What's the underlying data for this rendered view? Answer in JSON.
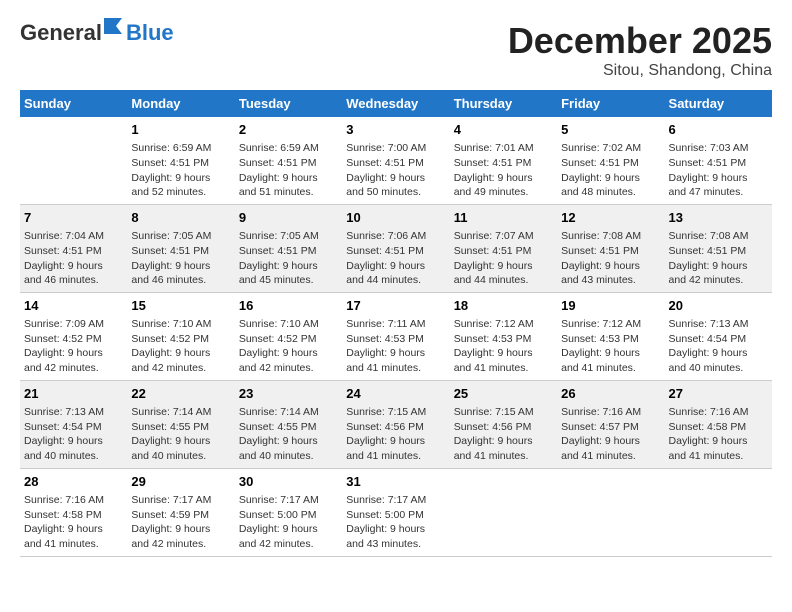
{
  "header": {
    "logo_general": "General",
    "logo_blue": "Blue",
    "title": "December 2025",
    "subtitle": "Sitou, Shandong, China"
  },
  "calendar": {
    "days_of_week": [
      "Sunday",
      "Monday",
      "Tuesday",
      "Wednesday",
      "Thursday",
      "Friday",
      "Saturday"
    ],
    "weeks": [
      [
        {
          "day": "",
          "info": ""
        },
        {
          "day": "1",
          "info": "Sunrise: 6:59 AM\nSunset: 4:51 PM\nDaylight: 9 hours\nand 52 minutes."
        },
        {
          "day": "2",
          "info": "Sunrise: 6:59 AM\nSunset: 4:51 PM\nDaylight: 9 hours\nand 51 minutes."
        },
        {
          "day": "3",
          "info": "Sunrise: 7:00 AM\nSunset: 4:51 PM\nDaylight: 9 hours\nand 50 minutes."
        },
        {
          "day": "4",
          "info": "Sunrise: 7:01 AM\nSunset: 4:51 PM\nDaylight: 9 hours\nand 49 minutes."
        },
        {
          "day": "5",
          "info": "Sunrise: 7:02 AM\nSunset: 4:51 PM\nDaylight: 9 hours\nand 48 minutes."
        },
        {
          "day": "6",
          "info": "Sunrise: 7:03 AM\nSunset: 4:51 PM\nDaylight: 9 hours\nand 47 minutes."
        }
      ],
      [
        {
          "day": "7",
          "info": "Sunrise: 7:04 AM\nSunset: 4:51 PM\nDaylight: 9 hours\nand 46 minutes."
        },
        {
          "day": "8",
          "info": "Sunrise: 7:05 AM\nSunset: 4:51 PM\nDaylight: 9 hours\nand 46 minutes."
        },
        {
          "day": "9",
          "info": "Sunrise: 7:05 AM\nSunset: 4:51 PM\nDaylight: 9 hours\nand 45 minutes."
        },
        {
          "day": "10",
          "info": "Sunrise: 7:06 AM\nSunset: 4:51 PM\nDaylight: 9 hours\nand 44 minutes."
        },
        {
          "day": "11",
          "info": "Sunrise: 7:07 AM\nSunset: 4:51 PM\nDaylight: 9 hours\nand 44 minutes."
        },
        {
          "day": "12",
          "info": "Sunrise: 7:08 AM\nSunset: 4:51 PM\nDaylight: 9 hours\nand 43 minutes."
        },
        {
          "day": "13",
          "info": "Sunrise: 7:08 AM\nSunset: 4:51 PM\nDaylight: 9 hours\nand 42 minutes."
        }
      ],
      [
        {
          "day": "14",
          "info": "Sunrise: 7:09 AM\nSunset: 4:52 PM\nDaylight: 9 hours\nand 42 minutes."
        },
        {
          "day": "15",
          "info": "Sunrise: 7:10 AM\nSunset: 4:52 PM\nDaylight: 9 hours\nand 42 minutes."
        },
        {
          "day": "16",
          "info": "Sunrise: 7:10 AM\nSunset: 4:52 PM\nDaylight: 9 hours\nand 42 minutes."
        },
        {
          "day": "17",
          "info": "Sunrise: 7:11 AM\nSunset: 4:53 PM\nDaylight: 9 hours\nand 41 minutes."
        },
        {
          "day": "18",
          "info": "Sunrise: 7:12 AM\nSunset: 4:53 PM\nDaylight: 9 hours\nand 41 minutes."
        },
        {
          "day": "19",
          "info": "Sunrise: 7:12 AM\nSunset: 4:53 PM\nDaylight: 9 hours\nand 41 minutes."
        },
        {
          "day": "20",
          "info": "Sunrise: 7:13 AM\nSunset: 4:54 PM\nDaylight: 9 hours\nand 40 minutes."
        }
      ],
      [
        {
          "day": "21",
          "info": "Sunrise: 7:13 AM\nSunset: 4:54 PM\nDaylight: 9 hours\nand 40 minutes."
        },
        {
          "day": "22",
          "info": "Sunrise: 7:14 AM\nSunset: 4:55 PM\nDaylight: 9 hours\nand 40 minutes."
        },
        {
          "day": "23",
          "info": "Sunrise: 7:14 AM\nSunset: 4:55 PM\nDaylight: 9 hours\nand 40 minutes."
        },
        {
          "day": "24",
          "info": "Sunrise: 7:15 AM\nSunset: 4:56 PM\nDaylight: 9 hours\nand 41 minutes."
        },
        {
          "day": "25",
          "info": "Sunrise: 7:15 AM\nSunset: 4:56 PM\nDaylight: 9 hours\nand 41 minutes."
        },
        {
          "day": "26",
          "info": "Sunrise: 7:16 AM\nSunset: 4:57 PM\nDaylight: 9 hours\nand 41 minutes."
        },
        {
          "day": "27",
          "info": "Sunrise: 7:16 AM\nSunset: 4:58 PM\nDaylight: 9 hours\nand 41 minutes."
        }
      ],
      [
        {
          "day": "28",
          "info": "Sunrise: 7:16 AM\nSunset: 4:58 PM\nDaylight: 9 hours\nand 41 minutes."
        },
        {
          "day": "29",
          "info": "Sunrise: 7:17 AM\nSunset: 4:59 PM\nDaylight: 9 hours\nand 42 minutes."
        },
        {
          "day": "30",
          "info": "Sunrise: 7:17 AM\nSunset: 5:00 PM\nDaylight: 9 hours\nand 42 minutes."
        },
        {
          "day": "31",
          "info": "Sunrise: 7:17 AM\nSunset: 5:00 PM\nDaylight: 9 hours\nand 43 minutes."
        },
        {
          "day": "",
          "info": ""
        },
        {
          "day": "",
          "info": ""
        },
        {
          "day": "",
          "info": ""
        }
      ]
    ]
  }
}
